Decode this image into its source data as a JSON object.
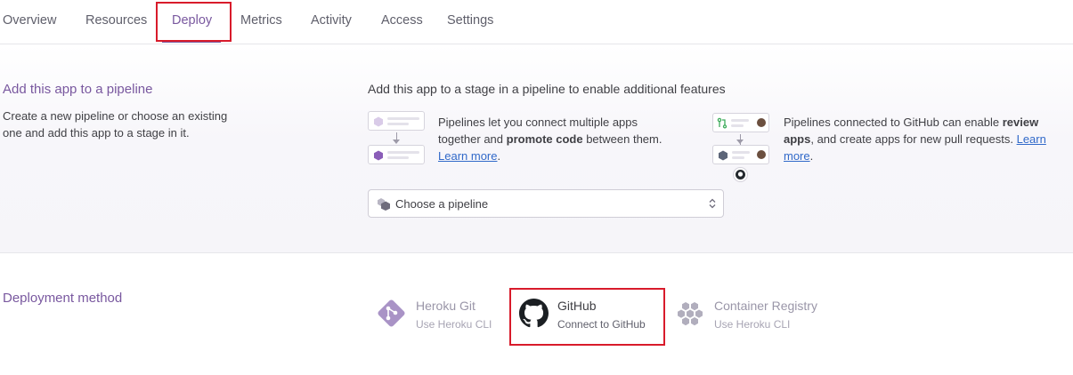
{
  "tabs": [
    {
      "label": "Overview"
    },
    {
      "label": "Resources"
    },
    {
      "label": "Deploy"
    },
    {
      "label": "Metrics"
    },
    {
      "label": "Activity"
    },
    {
      "label": "Access"
    },
    {
      "label": "Settings"
    }
  ],
  "active_tab": "Deploy",
  "pipeline": {
    "title": "Add this app to a pipeline",
    "description": "Create a new pipeline or choose an existing one and add this app to a stage in it.",
    "stage_heading": "Add this app to a stage in a pipeline to enable additional features",
    "feature_1": {
      "text_a": "Pipelines let you connect multiple apps together and ",
      "bold": "promote code",
      "text_b": " between them. ",
      "link": "Learn more",
      "end": "."
    },
    "feature_2": {
      "text_a": "Pipelines connected to GitHub can enable ",
      "bold": "review apps",
      "text_b": ", and create apps for new pull requests. ",
      "link": "Learn more",
      "end": "."
    },
    "select": {
      "placeholder": "Choose a pipeline"
    }
  },
  "deployment": {
    "title": "Deployment method",
    "methods": [
      {
        "name": "Heroku Git",
        "sub": "Use Heroku CLI",
        "icon": "heroku-git-icon"
      },
      {
        "name": "GitHub",
        "sub": "Connect to GitHub",
        "icon": "github-icon"
      },
      {
        "name": "Container Registry",
        "sub": "Use Heroku CLI",
        "icon": "container-registry-icon"
      }
    ]
  },
  "colors": {
    "accent": "#79589f",
    "highlight": "#d81b2b",
    "link": "#3169c9"
  }
}
